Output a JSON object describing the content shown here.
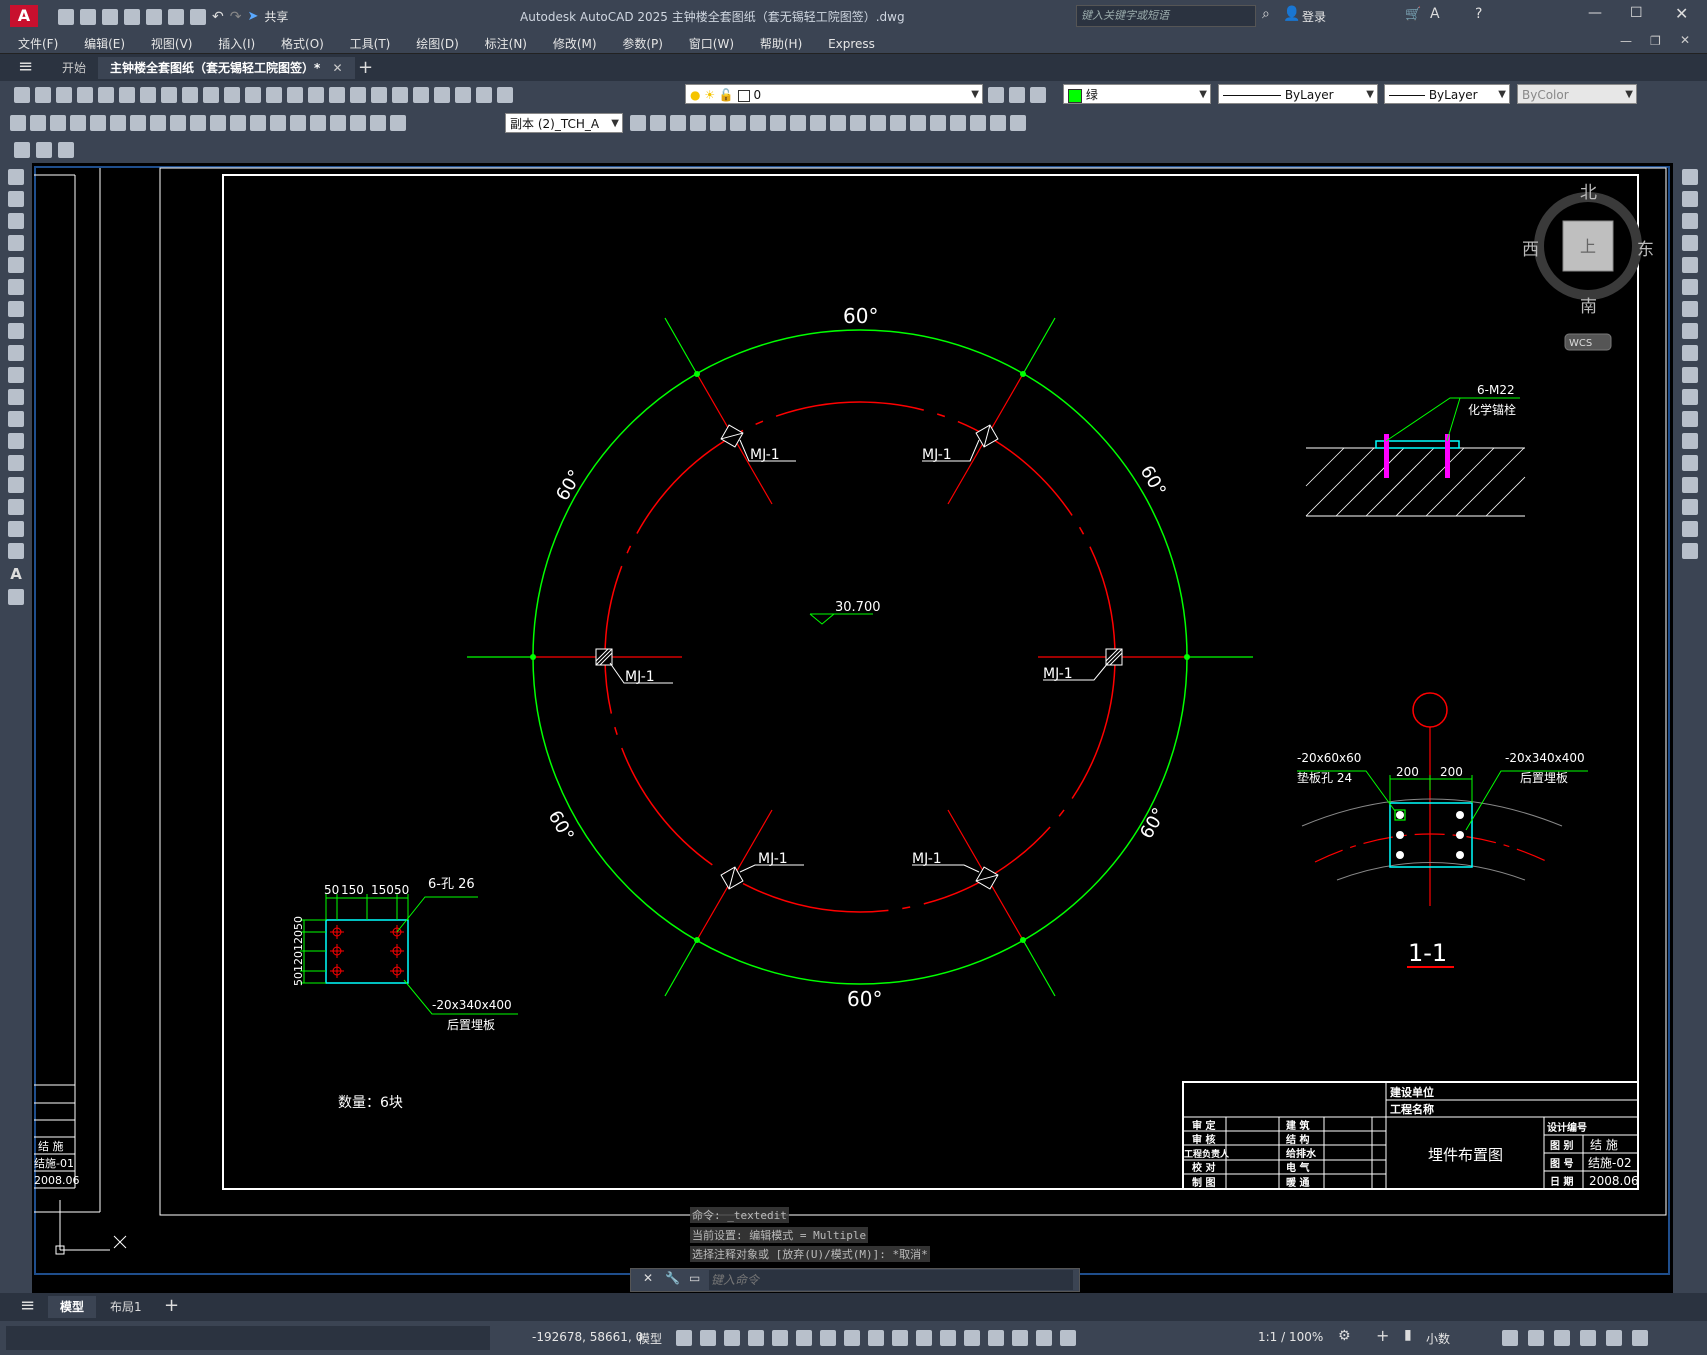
{
  "titlebar": {
    "app_letter": "A",
    "share_label": "共享",
    "title": "Autodesk AutoCAD 2025    主钟楼全套图纸（套无锡轻工院图签）.dwg",
    "search_placeholder": "键入关键字或短语",
    "login_label": "登录"
  },
  "menu": {
    "items": [
      "文件(F)",
      "编辑(E)",
      "视图(V)",
      "插入(I)",
      "格式(O)",
      "工具(T)",
      "绘图(D)",
      "标注(N)",
      "修改(M)",
      "参数(P)",
      "窗口(W)",
      "帮助(H)",
      "Express"
    ]
  },
  "tabs": {
    "start": "开始",
    "active": "主钟楼全套图纸（套无锡轻工院图签）*"
  },
  "toolbar": {
    "layer_value": "0",
    "color_value": "绿",
    "linetype_value": "ByLayer",
    "lineweight_value": "ByLayer",
    "plotstyle_value": "ByColor",
    "textstyle_value": "副本 (2)_TCH_A"
  },
  "viewcube": {
    "north": "北",
    "south": "南",
    "east": "东",
    "west": "西",
    "top_face": "上",
    "wcs": "WCS"
  },
  "drawing": {
    "angle_label": "60°",
    "marker_label": "MJ-1",
    "elevation": "30.700",
    "count_note": "数量：6块",
    "anchor_spec": "6-M22",
    "anchor_name": "化学锚栓",
    "plate_left_dims": [
      "50",
      "150",
      "150",
      "50"
    ],
    "plate_left_vert_dims": "5012012050",
    "hole_spec": "6-孔  26",
    "plate_spec": "-20x340x400",
    "plate_name": "后置埋板",
    "washer_spec": "-20x60x60",
    "washer_name": "垫板孔  24",
    "section_dims": [
      "200",
      "200"
    ],
    "section_label": "1-1",
    "left_block": [
      "结 施",
      "结施-01",
      "2008.06"
    ]
  },
  "title_block": {
    "build_unit": "建设单位",
    "project_name": "工程名称",
    "roles_left": [
      "审  定",
      "审  核",
      "工程负责人",
      "校  对",
      "制  图"
    ],
    "roles_mid": [
      "建  筑",
      "结  构",
      "给排水",
      "电  气",
      "暖  通"
    ],
    "drawing_title": "埋件布置图",
    "design_no_label": "设计编号",
    "fields": [
      [
        "图 别",
        "结 施"
      ],
      [
        "图 号",
        "结施-02"
      ],
      [
        "日 期",
        "2008.06"
      ]
    ]
  },
  "command": {
    "lines": [
      "命令: _textedit",
      "当前设置: 编辑模式 = Multiple",
      "选择注释对象或 [放弃(U)/模式(M)]: *取消*"
    ],
    "input_placeholder": "键入命令"
  },
  "layout_tabs": {
    "model": "模型",
    "layout1": "布局1"
  },
  "status": {
    "coords": "-192678, 58661, 0",
    "model": "模型",
    "scale": "1:1 / 100%",
    "units": "小数"
  },
  "colors": {
    "green": "#00ff00",
    "red": "#ff0000",
    "cyan": "#00ffff",
    "magenta": "#ff00ff",
    "frame": "#1f4e8c"
  }
}
